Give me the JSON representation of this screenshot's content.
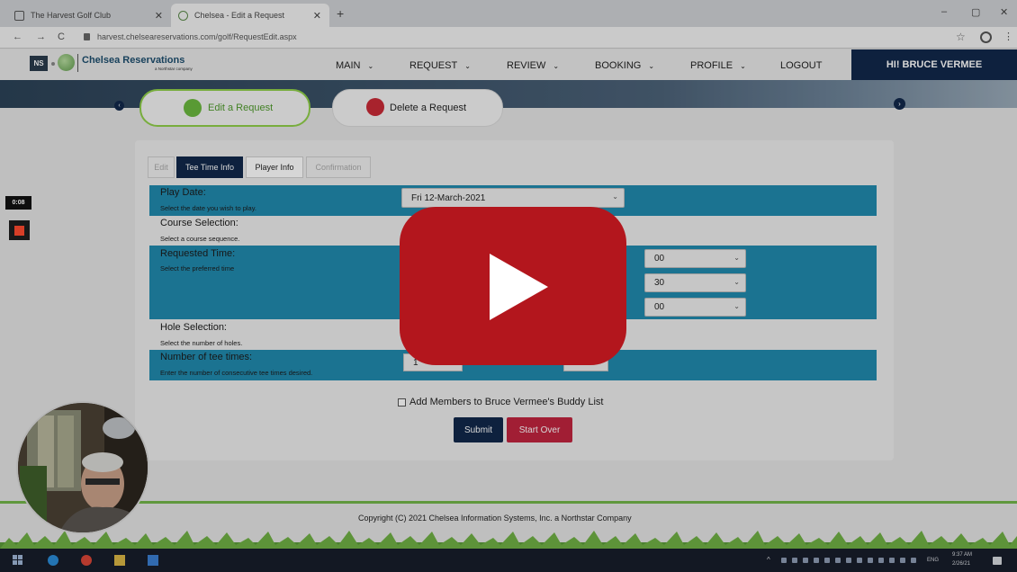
{
  "browser": {
    "tabs": [
      {
        "title": "The Harvest Golf Club",
        "close": "✕"
      },
      {
        "title": "Chelsea - Edit a Request",
        "close": "✕"
      }
    ],
    "new_tab": "+",
    "window_controls": {
      "minimize": "–",
      "restore": "▢",
      "close": "✕"
    },
    "nav": {
      "back": "←",
      "forward": "→",
      "reload": "C"
    },
    "url": "harvest.chelseareservations.com/golf/RequestEdit.aspx",
    "bookmark_icon": "star-icon",
    "menu_glyph": "⋮"
  },
  "site": {
    "logo_badge": "NS",
    "logo_title": "Chelsea Reservations",
    "logo_sub": "a Northstar company",
    "menu": [
      {
        "label": "MAIN",
        "caret": "⌄"
      },
      {
        "label": "REQUEST",
        "caret": "⌄"
      },
      {
        "label": "REVIEW",
        "caret": "⌄"
      },
      {
        "label": "BOOKING",
        "caret": "⌄"
      },
      {
        "label": "PROFILE",
        "caret": "⌄"
      },
      {
        "label": "LOGOUT"
      }
    ],
    "greeting": "HI! BRUCE VERMEE"
  },
  "actions": {
    "edit_request": "Edit a Request",
    "delete_request": "Delete a Request",
    "prev_glyph": "‹",
    "next_glyph": "›"
  },
  "form": {
    "steps": [
      "Edit",
      "Tee Time Info",
      "Player Info",
      "Confirmation"
    ],
    "active_step": "Tee Time Info",
    "rows": [
      {
        "label": "Play Date:",
        "hint": "Select the date you wish to play."
      },
      {
        "label": "Course Selection:",
        "hint": "Select a course sequence."
      },
      {
        "label": "Requested Time:",
        "hint": "Select the preferred time"
      },
      {
        "label": "Hole Selection:",
        "hint": "Select the number of holes."
      },
      {
        "label": "Number of tee times:",
        "hint": "Enter the number of consecutive tee times desired."
      }
    ],
    "play_date_value": "Fri 12-March-2021",
    "time_selects": [
      "00",
      "30",
      "00"
    ],
    "tee_times_value": "1",
    "chevron": "⌄",
    "buddy_checkbox_label": "Add Members to Bruce Vermee's Buddy List",
    "submit_label": "Submit",
    "start_over_label": "Start Over"
  },
  "footer": {
    "copyright": "Copyright (C) 2021 Chelsea Information Systems, Inc. a Northstar Company"
  },
  "taskbar": {
    "lang": "ENG",
    "time": "9:37 AM",
    "date": "2/26/21"
  },
  "recorder": {
    "timer": "0:08"
  },
  "video": {
    "play_icon": "play-button-icon"
  },
  "colors": {
    "navy": "#11284a",
    "band_blue": "#2189ad",
    "accent_green": "#6bb83e",
    "accent_red": "#c0243e",
    "play_red": "#b3161d"
  }
}
